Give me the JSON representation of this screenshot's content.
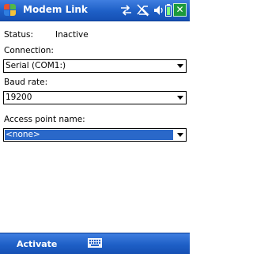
{
  "titlebar": {
    "title": "Modem Link",
    "icons": [
      "start-menu-icon",
      "connectivity-icon",
      "signal-off-icon",
      "volume-icon",
      "battery-icon"
    ],
    "close_label": "✕"
  },
  "form": {
    "status_label": "Status:",
    "status_value": "Inactive",
    "connection_label": "Connection:",
    "connection_value": "Serial (COM1:)",
    "baud_label": "Baud rate:",
    "baud_value": "19200",
    "apn_label": "Access point name:",
    "apn_value": "<none>"
  },
  "bottombar": {
    "softkey_label": "Activate",
    "sip_icon": "keyboard-icon"
  },
  "colors": {
    "bar_blue": "#1e5fc6",
    "selection": "#2a68c9",
    "close_green": "#1c9a3c"
  }
}
